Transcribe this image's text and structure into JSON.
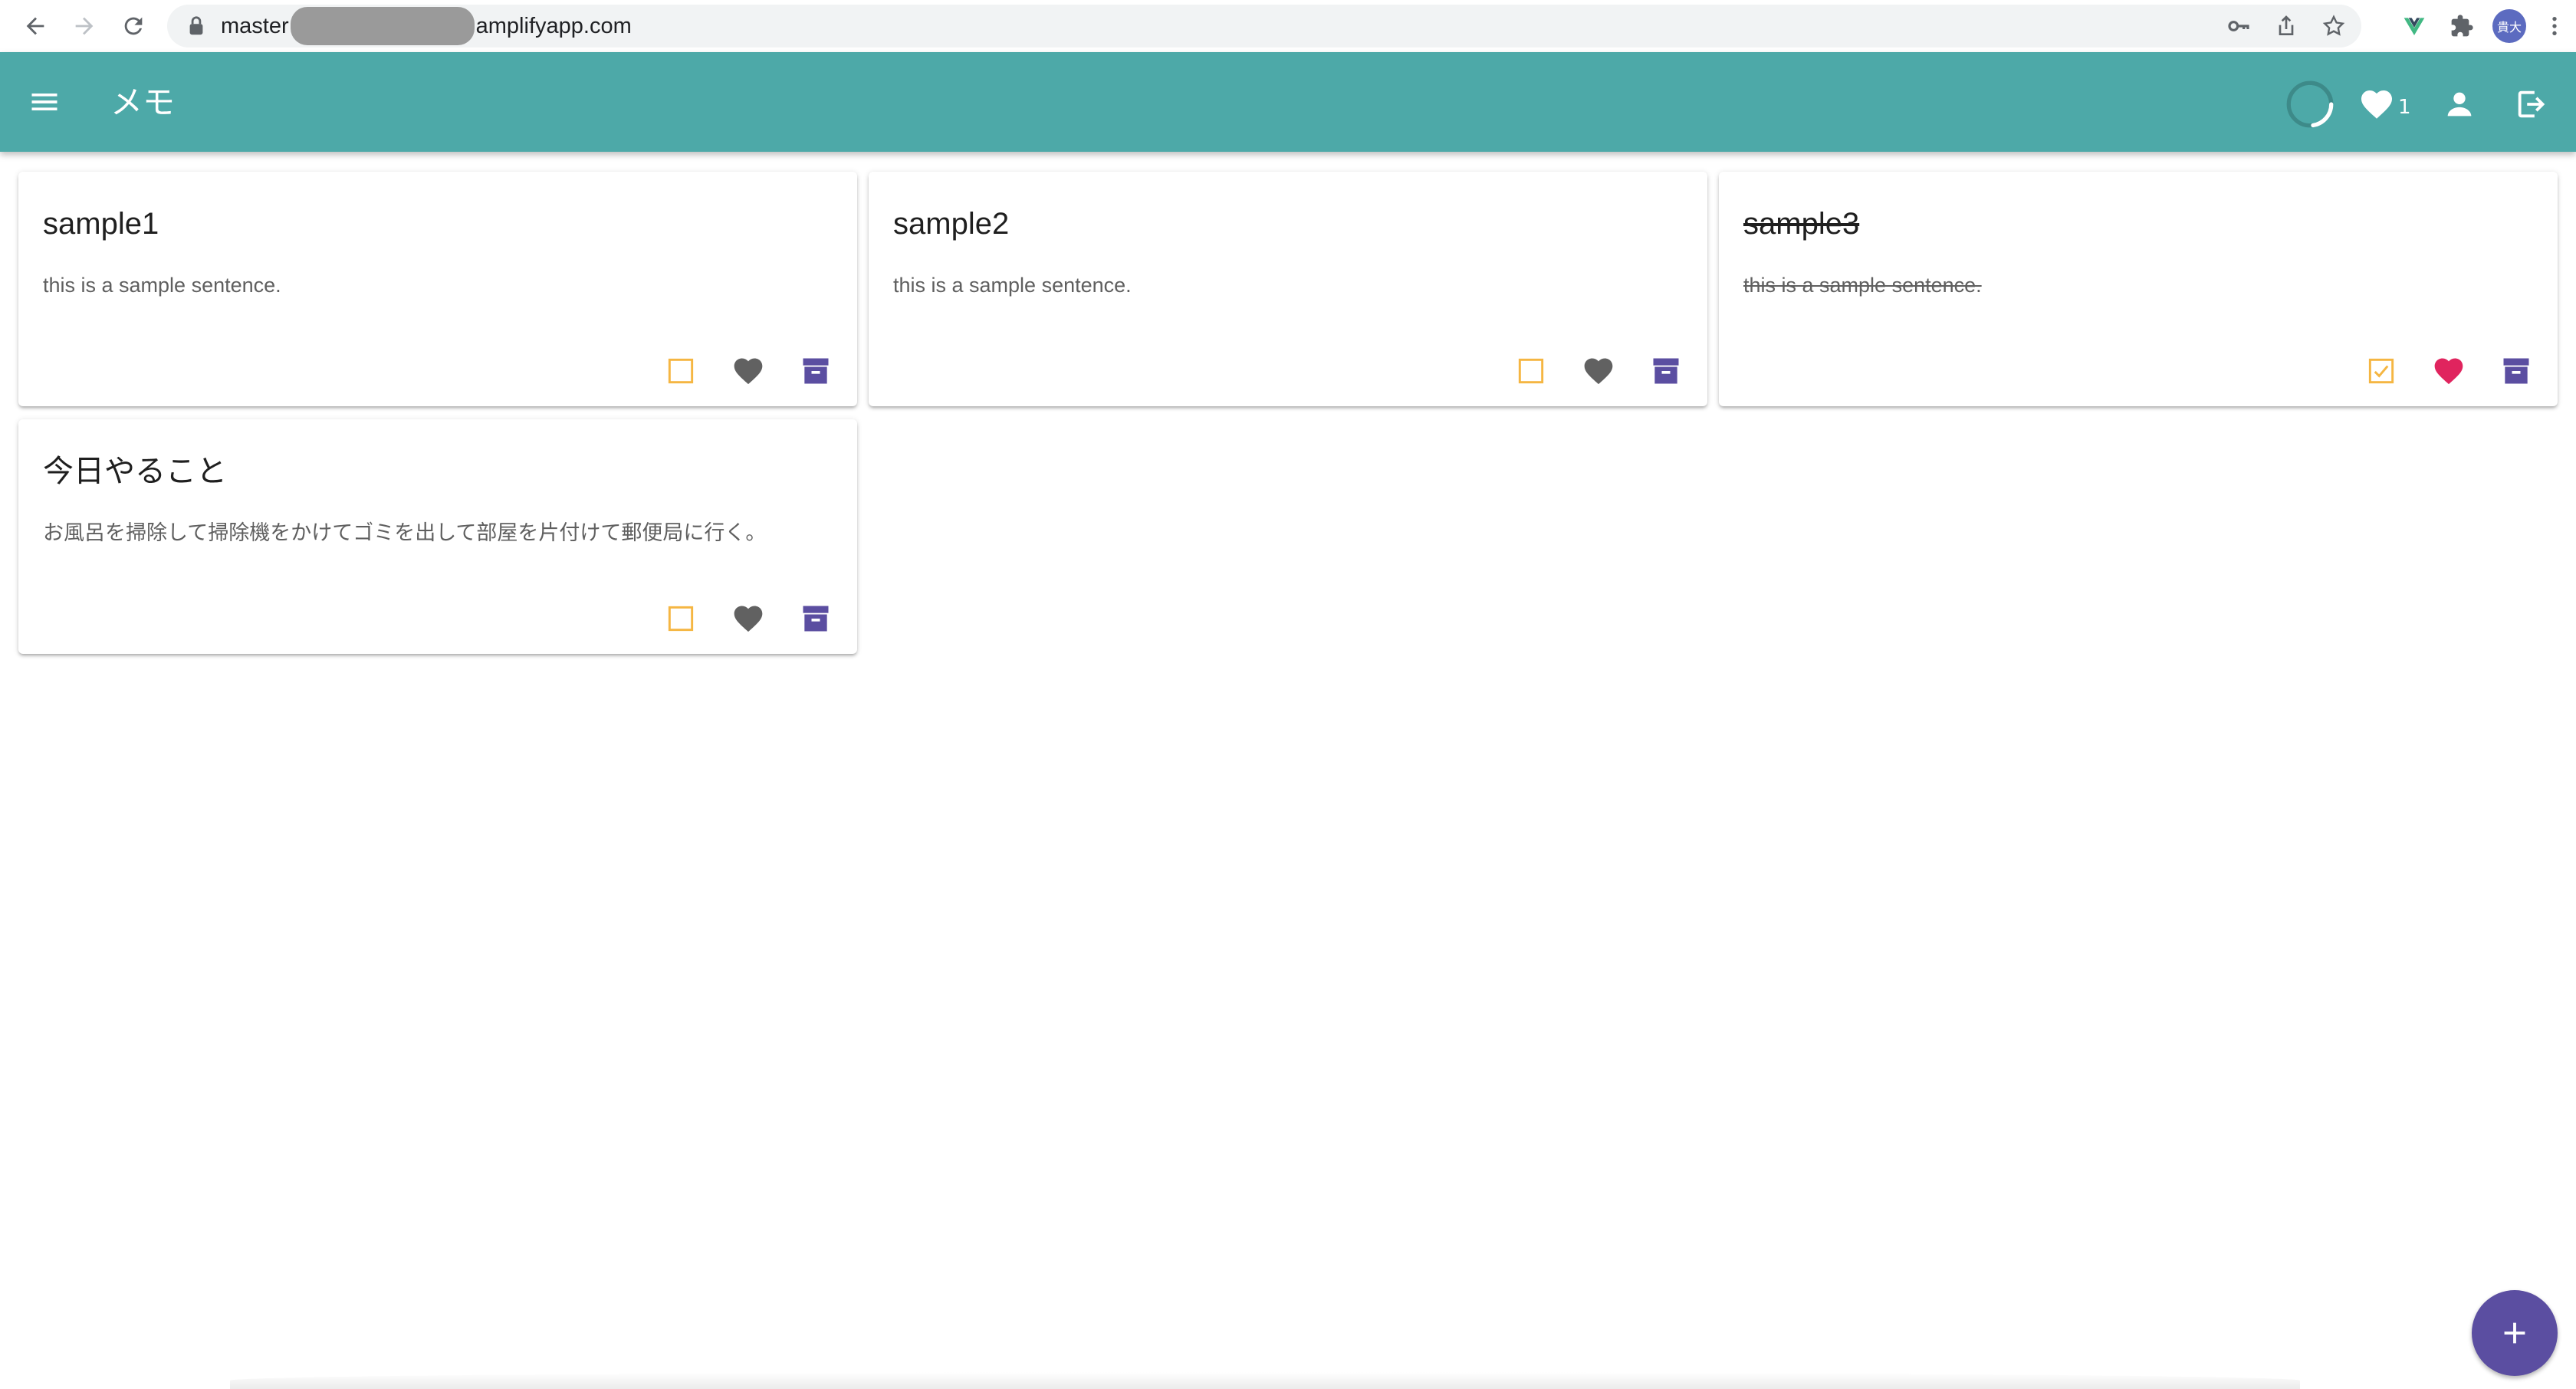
{
  "browser": {
    "url_prefix": "master",
    "url_suffix": "amplifyapp.com",
    "profile_initials": "貴大"
  },
  "appbar": {
    "title": "メモ",
    "favorite_count": "1",
    "color": "#4da9a8"
  },
  "memos": [
    {
      "title": "sample1",
      "text": "this is a sample sentence.",
      "done": false,
      "favorite": false
    },
    {
      "title": "sample2",
      "text": "this is a sample sentence.",
      "done": false,
      "favorite": false
    },
    {
      "title": "sample3",
      "text": "this is a sample sentence.",
      "done": true,
      "favorite": true
    },
    {
      "title": "今日やること",
      "text": "お風呂を掃除して掃除機をかけてゴミを出して部屋を片付けて郵便局に行く。",
      "done": false,
      "favorite": false
    }
  ],
  "colors": {
    "checkbox": "#f5b642",
    "heart_inactive": "#616161",
    "heart_active": "#e0245e",
    "archive": "#5b4ea1",
    "fab": "#5b4ea1"
  },
  "icons": {
    "menu": "menu-icon",
    "favorite": "heart-icon",
    "account": "account-icon",
    "logout": "logout-icon",
    "checkbox": "checkbox-icon",
    "archive": "archive-icon",
    "add": "plus-icon"
  }
}
